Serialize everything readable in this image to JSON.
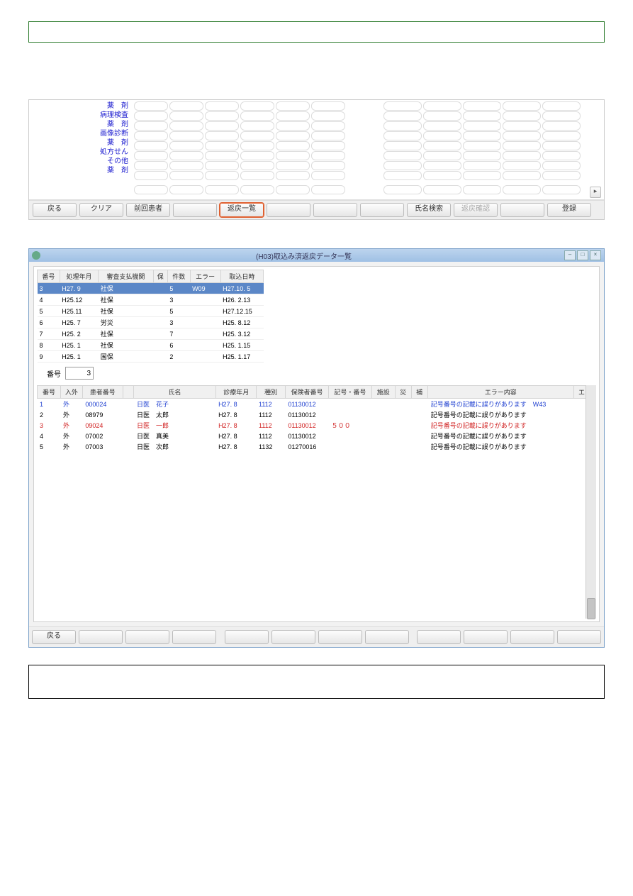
{
  "upper": {
    "side_labels": [
      "薬　剤",
      "病理検査",
      "薬　剤",
      "画像診断",
      "薬　剤",
      "処方せん",
      "その他",
      "薬　剤"
    ],
    "buttons": {
      "back": "戻る",
      "clear": "クリア",
      "prev_patient": "前回患者",
      "return_list": "返戻一覧",
      "name_search": "氏名検索",
      "return_confirm": "返戻確認",
      "register": "登録"
    }
  },
  "window": {
    "title": "(H03)取込み済返戻データ一覧",
    "summary": {
      "headers": [
        "番号",
        "処理年月",
        "審査支払機関",
        "保",
        "件数",
        "エラー",
        "取込日時"
      ],
      "rows": [
        {
          "no": "3",
          "ym": "H27. 9",
          "org": "社保",
          "hk": "",
          "cnt": "5",
          "err": "W09",
          "date": "H27.10. 5",
          "selected": true
        },
        {
          "no": "4",
          "ym": "H25.12",
          "org": "社保",
          "hk": "",
          "cnt": "3",
          "err": "",
          "date": "H26. 2.13"
        },
        {
          "no": "5",
          "ym": "H25.11",
          "org": "社保",
          "hk": "",
          "cnt": "5",
          "err": "",
          "date": "H27.12.15"
        },
        {
          "no": "6",
          "ym": "H25. 7",
          "org": "労災",
          "hk": "",
          "cnt": "3",
          "err": "",
          "date": "H25. 8.12"
        },
        {
          "no": "7",
          "ym": "H25. 2",
          "org": "社保",
          "hk": "",
          "cnt": "7",
          "err": "",
          "date": "H25. 3.12"
        },
        {
          "no": "8",
          "ym": "H25. 1",
          "org": "社保",
          "hk": "",
          "cnt": "6",
          "err": "",
          "date": "H25. 1.15"
        },
        {
          "no": "9",
          "ym": "H25. 1",
          "org": "国保",
          "hk": "",
          "cnt": "2",
          "err": "",
          "date": "H25. 1.17"
        }
      ]
    },
    "selected_no_label": "番号",
    "selected_no_value": "3",
    "detail": {
      "headers": [
        "番号",
        "入外",
        "患者番号",
        "",
        "氏名",
        "診療年月",
        "種別",
        "保険者番号",
        "記号・番号",
        "施設",
        "災",
        "補",
        "エラー内容",
        "エラ"
      ],
      "rows": [
        {
          "no": "1",
          "io": "外",
          "pid": "000024",
          "fam": "日医",
          "giv": "花子",
          "ym": "H27. 8",
          "type": "1112",
          "ins": "01130012",
          "sym": "",
          "msg": "記号番号の記載に誤りがあります　W43",
          "cls": "blue"
        },
        {
          "no": "2",
          "io": "外",
          "pid": "08979",
          "fam": "日医",
          "giv": "太郎",
          "ym": "H27. 8",
          "type": "1112",
          "ins": "01130012",
          "sym": "",
          "msg": "記号番号の記載に誤りがあります",
          "cls": ""
        },
        {
          "no": "3",
          "io": "外",
          "pid": "09024",
          "fam": "日医",
          "giv": "一郎",
          "ym": "H27. 8",
          "type": "1112",
          "ins": "01130012",
          "sym": "５００",
          "msg": "記号番号の記載に誤りがあります",
          "cls": "red"
        },
        {
          "no": "4",
          "io": "外",
          "pid": "07002",
          "fam": "日医",
          "giv": "真美",
          "ym": "H27. 8",
          "type": "1112",
          "ins": "01130012",
          "sym": "",
          "msg": "記号番号の記載に誤りがあります",
          "cls": ""
        },
        {
          "no": "5",
          "io": "外",
          "pid": "07003",
          "fam": "日医",
          "giv": "次郎",
          "ym": "H27. 8",
          "type": "1132",
          "ins": "01270016",
          "sym": "",
          "msg": "記号番号の記載に誤りがあります",
          "cls": ""
        }
      ]
    },
    "bottom_back": "戻る"
  }
}
